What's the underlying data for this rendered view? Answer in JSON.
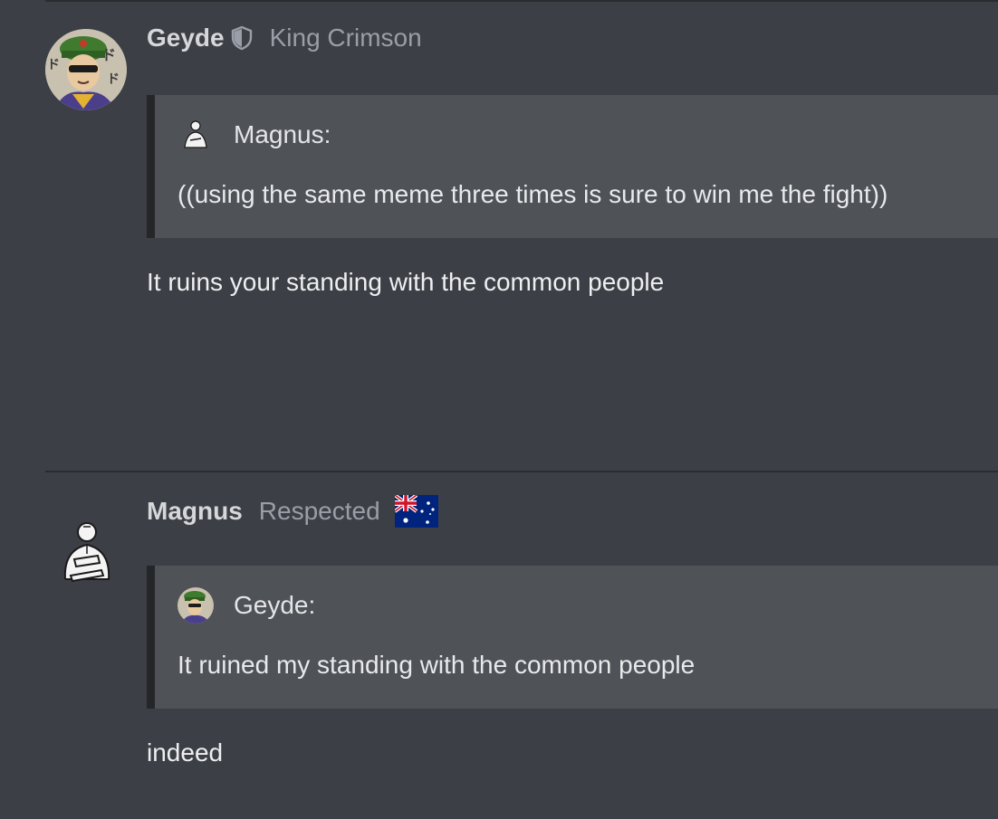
{
  "posts": [
    {
      "username": "Geyde",
      "user_title": "King Crimson",
      "badge_icon": "shield-icon",
      "quote": {
        "author": "Magnus:",
        "text": "((using the same meme three times is sure to win me the fight))"
      },
      "message": "It ruins your standing with the common people"
    },
    {
      "username": "Magnus",
      "user_title": "Respected",
      "flag_icon": "australia-flag-icon",
      "quote": {
        "author": "Geyde:",
        "text": "It ruined my standing with the common people"
      },
      "message": "indeed"
    }
  ],
  "colors": {
    "background": "#3d3f46",
    "quote_background": "#4f5257",
    "quote_border": "#252629",
    "title_text": "#9a9ea8"
  }
}
